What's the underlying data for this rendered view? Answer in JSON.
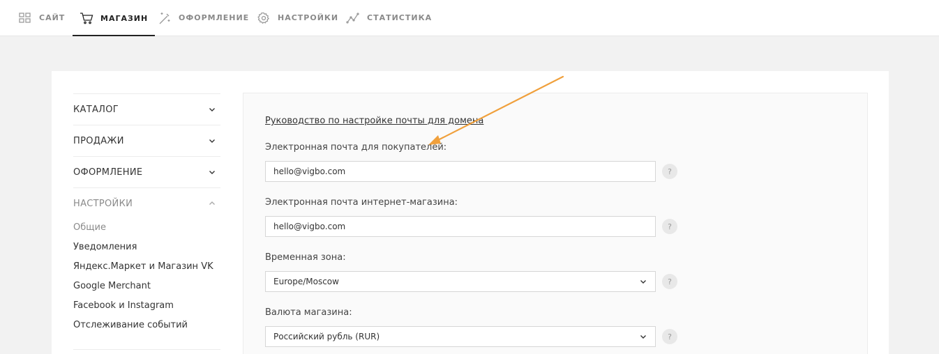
{
  "nav": {
    "items": [
      {
        "label": "САЙТ",
        "icon": "grid-icon"
      },
      {
        "label": "МАГАЗИН",
        "icon": "cart-icon",
        "active": true
      },
      {
        "label": "ОФОРМЛЕНИЕ",
        "icon": "magic-wand-icon"
      },
      {
        "label": "НАСТРОЙКИ",
        "icon": "gear-icon"
      },
      {
        "label": "СТАТИСТИКА",
        "icon": "line-chart-icon"
      }
    ]
  },
  "sidebar": {
    "sections": [
      {
        "label": "КАТАЛОГ",
        "expanded": false
      },
      {
        "label": "ПРОДАЖИ",
        "expanded": false
      },
      {
        "label": "ОФОРМЛЕНИЕ",
        "expanded": false
      },
      {
        "label": "НАСТРОЙКИ",
        "expanded": true
      }
    ],
    "subitems": [
      {
        "label": "Общие",
        "active": true
      },
      {
        "label": "Уведомления"
      },
      {
        "label": "Яндекс.Маркет и Магазин VK"
      },
      {
        "label": "Google Merchant"
      },
      {
        "label": "Facebook и Instagram"
      },
      {
        "label": "Отслеживание событий"
      }
    ]
  },
  "form": {
    "guide_link": "Руководство по настройке почты для домена",
    "customer_email": {
      "label": "Электронная почта для покупателей:",
      "value": "hello@vigbo.com"
    },
    "shop_email": {
      "label": "Электронная почта интернет-магазина:",
      "value": "hello@vigbo.com"
    },
    "timezone": {
      "label": "Временная зона:",
      "value": "Europe/Moscow"
    },
    "currency": {
      "label": "Валюта магазина:",
      "value": "Российский рубль (RUR)"
    },
    "help_glyph": "?"
  },
  "colors": {
    "arrow": "#f0a03c",
    "active_nav": "#222222",
    "muted": "#8a8a8a"
  }
}
